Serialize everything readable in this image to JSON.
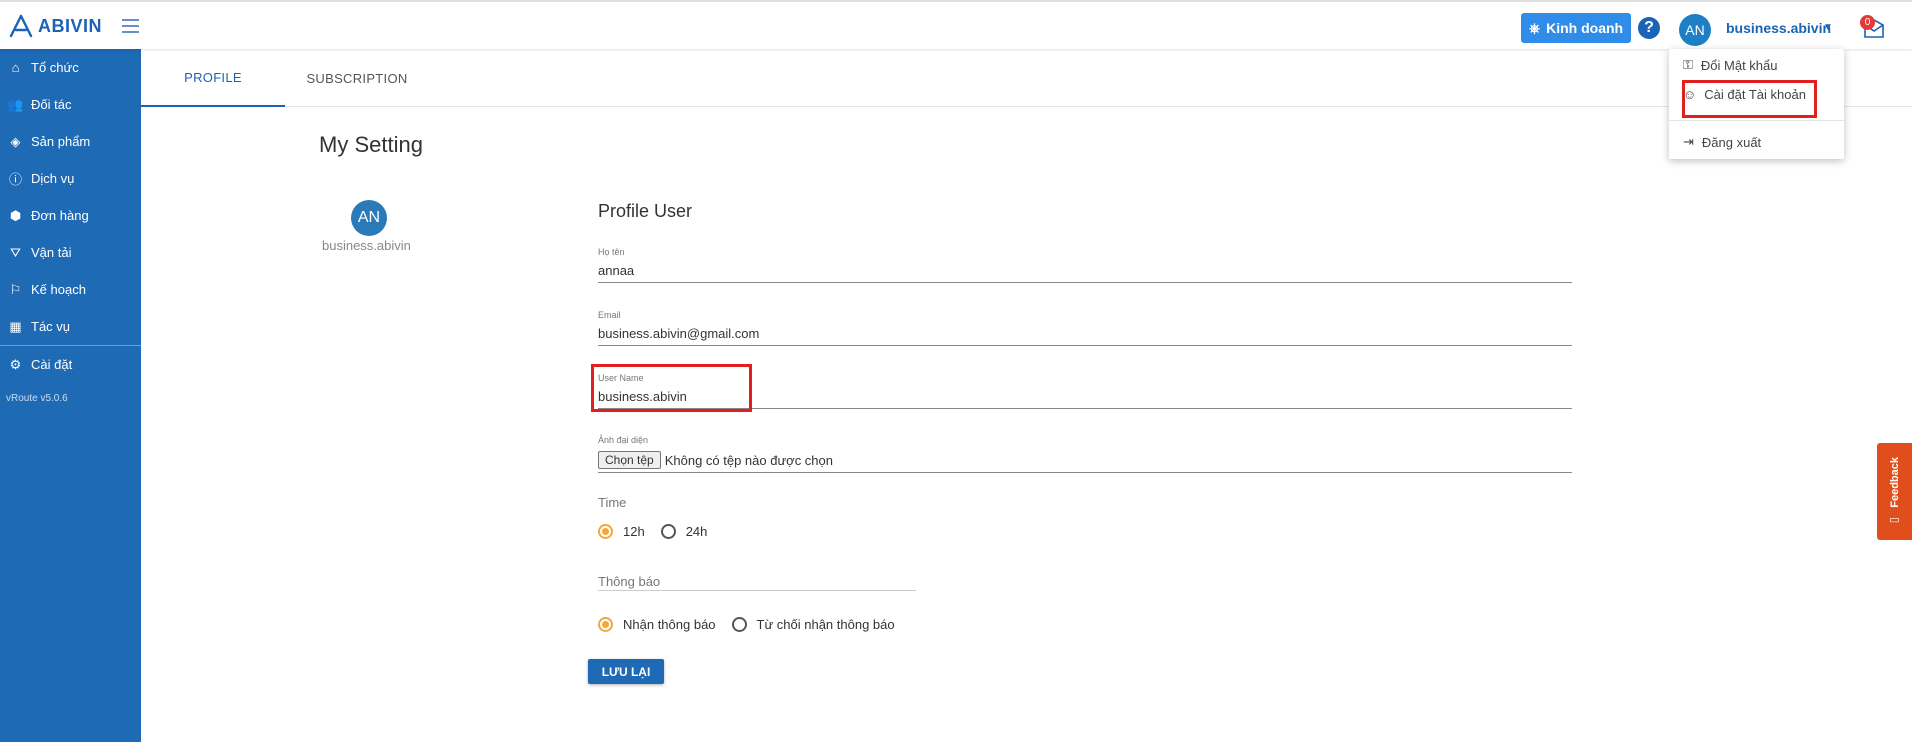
{
  "brand": {
    "name": "ABIVIN"
  },
  "topbar": {
    "business_button": "Kinh doanh",
    "help": "?",
    "avatar_initials": "AN",
    "username": "business.abivin",
    "notification_count": "0"
  },
  "sidebar": {
    "items": [
      {
        "label": "Tổ chức",
        "icon": "home-icon"
      },
      {
        "label": "Đối tác",
        "icon": "users-icon"
      },
      {
        "label": "Sản phẩm",
        "icon": "dropbox-icon"
      },
      {
        "label": "Dịch vụ",
        "icon": "info-icon"
      },
      {
        "label": "Đơn hàng",
        "icon": "cubes-icon"
      },
      {
        "label": "Vận tải",
        "icon": "road-icon"
      },
      {
        "label": "Kế hoạch",
        "icon": "route-icon"
      },
      {
        "label": "Tác vụ",
        "icon": "calendar-icon"
      },
      {
        "label": "Cài đặt",
        "icon": "gear-icon"
      }
    ],
    "version": "vRoute v5.0.6"
  },
  "tabs": [
    {
      "label": "PROFILE",
      "active": true
    },
    {
      "label": "SUBSCRIPTION",
      "active": false
    }
  ],
  "page": {
    "title": "My Setting",
    "avatar_initials": "AN",
    "username": "business.abivin"
  },
  "form": {
    "title": "Profile User",
    "fullname": {
      "label": "Họ tên",
      "value": "annaa"
    },
    "email": {
      "label": "Email",
      "value": "business.abivin@gmail.com"
    },
    "username": {
      "label": "User Name",
      "value": "business.abivin"
    },
    "avatar": {
      "label": "Ảnh đại diện",
      "button": "Chọn tệp",
      "status": "Không có tệp nào được chọn"
    },
    "time": {
      "label": "Time",
      "options": [
        "12h",
        "24h"
      ],
      "selected": "12h"
    },
    "notification": {
      "label": "Thông báo",
      "options": [
        "Nhận thông báo",
        "Từ chối nhận thông báo"
      ],
      "selected": "Nhận thông báo"
    },
    "save_button": "LƯU LẠI"
  },
  "dropdown": {
    "items": [
      {
        "label": "Đổi Mật khẩu",
        "icon": "key-icon"
      },
      {
        "label": "Cài đặt Tài khoản",
        "icon": "user-icon"
      },
      {
        "label": "Đăng xuất",
        "icon": "logout-icon"
      }
    ]
  },
  "feedback": {
    "label": "Feedback"
  },
  "colors": {
    "primary": "#1e6ab5",
    "accent": "#f2a93b",
    "highlight": "#e0201a",
    "feedback": "#e04e1b"
  }
}
